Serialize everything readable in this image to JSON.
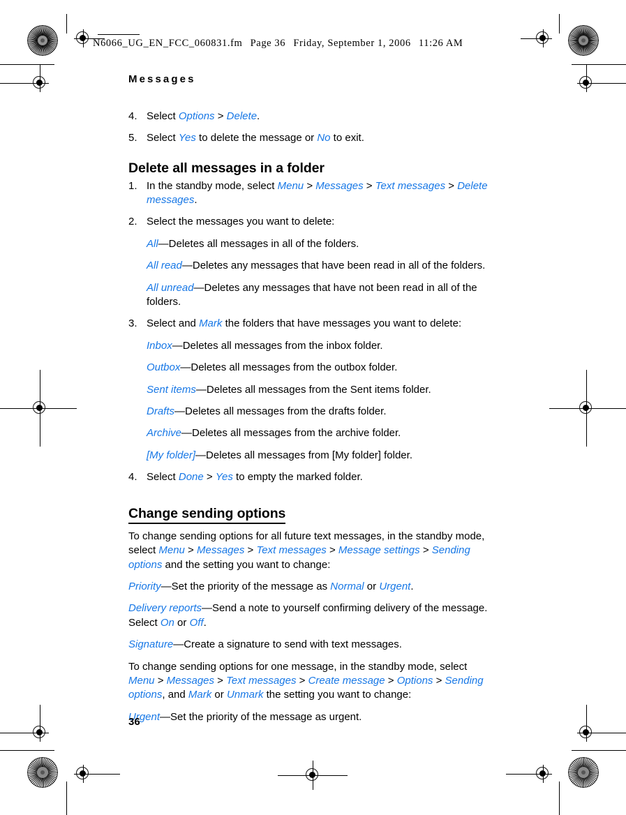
{
  "header": {
    "filename": "N6066_UG_EN_FCC_060831.fm",
    "page_label": "Page 36",
    "date": "Friday, September 1, 2006",
    "time": "11:26 AM"
  },
  "running_head": "Messages",
  "page_number": "36",
  "colors": {
    "ui_reference": "#1878e6",
    "text": "#000000",
    "background": "#ffffff"
  },
  "content": {
    "step4_label": "4.",
    "step4_prefix": "Select ",
    "step4_options": "Options",
    "step4_sep": " > ",
    "step4_delete": "Delete",
    "step4_suffix": ".",
    "step5_label": "5.",
    "step5_prefix": "Select ",
    "step5_yes": "Yes",
    "step5_mid": " to delete the message or ",
    "step5_no": "No",
    "step5_suffix": " to exit.",
    "heading_delete_all": "Delete all messages in a folder",
    "step1_label": "1.",
    "step1_prefix": "In the standby mode, select ",
    "step1_menu": "Menu",
    "step1_messages": "Messages",
    "step1_text_messages": "Text messages",
    "step1_delete_messages": "Delete messages",
    "step1_suffix": ".",
    "step2_label": "2.",
    "step2_text": "Select the messages you want to delete:",
    "def_all_term": "All",
    "def_all_desc": "—Deletes all messages in all of the folders.",
    "def_all_read_term": "All read",
    "def_all_read_desc": "—Deletes any messages that have been read in all of the folders.",
    "def_all_unread_term": "All unread",
    "def_all_unread_desc": "—Deletes any messages that have not been read in all of the folders.",
    "step3_label": "3.",
    "step3_prefix": "Select and ",
    "step3_mark": "Mark",
    "step3_suffix": " the folders that have messages you want to delete:",
    "def_inbox_term": "Inbox",
    "def_inbox_desc": "—Deletes all messages from the inbox folder.",
    "def_outbox_term": "Outbox",
    "def_outbox_desc": "—Deletes all messages from the outbox folder.",
    "def_sent_term": "Sent items",
    "def_sent_desc": "—Deletes all messages from the Sent items folder.",
    "def_drafts_term": "Drafts",
    "def_drafts_desc": "—Deletes all messages from the drafts folder.",
    "def_archive_term": "Archive",
    "def_archive_desc": "—Deletes all messages from the archive folder.",
    "def_myfolder_term": "[My folder]",
    "def_myfolder_desc": "—Deletes all messages from [My folder] folder.",
    "step4b_label": "4.",
    "step4b_prefix": "Select ",
    "step4b_done": "Done",
    "step4b_sep": " > ",
    "step4b_yes": "Yes",
    "step4b_suffix": " to empty the marked folder.",
    "heading_change_sending": "Change sending options",
    "p1_prefix": "To change sending options for all future text messages, in the standby mode, select ",
    "p1_menu": "Menu",
    "p1_messages": "Messages",
    "p1_text_messages": "Text messages",
    "p1_message_settings": "Message settings",
    "p1_sending_options": "Sending options",
    "p1_suffix": " and the setting you want to change:",
    "def_priority_term": "Priority",
    "def_priority_mid": "—Set the priority of the message as ",
    "def_priority_normal": "Normal",
    "def_priority_or": " or ",
    "def_priority_urgent": "Urgent",
    "def_priority_end": ".",
    "def_delivery_term": "Delivery reports",
    "def_delivery_mid": "—Send a note to yourself confirming delivery of the message. Select ",
    "def_delivery_on": "On",
    "def_delivery_or": " or ",
    "def_delivery_off": "Off",
    "def_delivery_end": ".",
    "def_signature_term": "Signature",
    "def_signature_desc": "—Create a signature to send with text messages.",
    "p2_prefix": "To change sending options for one message, in the standby mode, select ",
    "p2_menu": "Menu",
    "p2_messages": "Messages",
    "p2_text_messages": "Text messages",
    "p2_create_message": "Create message",
    "p2_options": "Options",
    "p2_sending_options": "Sending options",
    "p2_mid": ", and ",
    "p2_mark": "Mark",
    "p2_or": " or ",
    "p2_unmark": "Unmark",
    "p2_suffix": " the setting you want to change:",
    "def_urgent_term": "Urgent",
    "def_urgent_desc": "—Set the priority of the message as urgent."
  }
}
